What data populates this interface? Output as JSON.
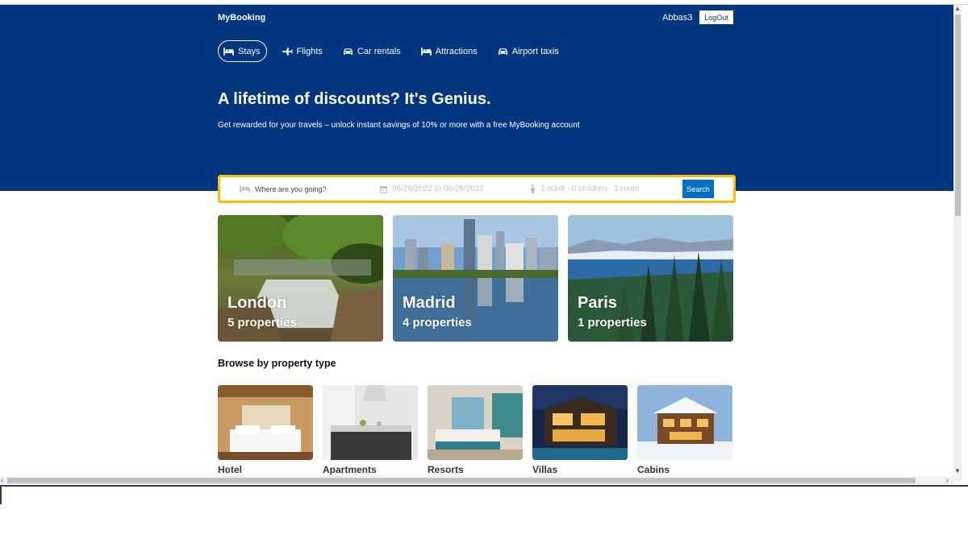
{
  "brand": "MyBooking",
  "user": {
    "name": "Abbas3",
    "logout_label": "LogOut"
  },
  "nav": [
    {
      "label": "Stays",
      "icon": "bed-icon",
      "active": true
    },
    {
      "label": "Flights",
      "icon": "plane-icon",
      "active": false
    },
    {
      "label": "Car rentals",
      "icon": "car-icon",
      "active": false
    },
    {
      "label": "Attractions",
      "icon": "bed-icon",
      "active": false
    },
    {
      "label": "Airport taxis",
      "icon": "taxi-icon",
      "active": false
    }
  ],
  "hero": {
    "title": "A lifetime of discounts? It's Genius.",
    "subtitle": "Get rewarded for your travels – unlock instant savings of 10% or more with a free MyBooking account"
  },
  "search": {
    "destination_placeholder": "Where are you going?",
    "dates": "06/28/2022 to 06/28/2022",
    "guests": "1 adult · 0 children · 1 room",
    "button_label": "Search"
  },
  "cities": [
    {
      "name": "London",
      "properties": "5 properties"
    },
    {
      "name": "Madrid",
      "properties": "4 properties"
    },
    {
      "name": "Paris",
      "properties": "1 properties"
    }
  ],
  "property_section_title": "Browse by property type",
  "property_types": [
    {
      "label": "Hotel"
    },
    {
      "label": "Apartments"
    },
    {
      "label": "Resorts"
    },
    {
      "label": "Villas"
    },
    {
      "label": "Cabins"
    }
  ],
  "colors": {
    "header_bg": "#003580",
    "search_border": "#febb02",
    "search_button": "#0071c2"
  }
}
